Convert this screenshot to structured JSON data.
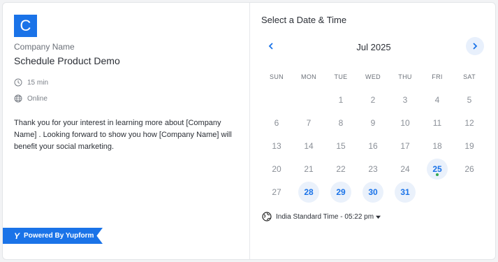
{
  "profile": {
    "logo_letter": "C",
    "company": "Company Name",
    "event_title": "Schedule Product Demo",
    "duration": "15 min",
    "location": "Online",
    "description": "Thank you for your interest in learning more about [Company Name] . Looking forward to show you how [Company Name] will benefit your social marketing."
  },
  "branding": {
    "powered_by": "Powered By Yupform",
    "brand_color": "#1a73e8"
  },
  "calendar": {
    "heading": "Select a Date & Time",
    "month": "Jul 2025",
    "weekdays": [
      "SUN",
      "MON",
      "TUE",
      "WED",
      "THU",
      "FRI",
      "SAT"
    ],
    "weeks": [
      [
        "",
        "",
        "1",
        "2",
        "3",
        "4",
        "5"
      ],
      [
        "6",
        "7",
        "8",
        "9",
        "10",
        "11",
        "12"
      ],
      [
        "13",
        "14",
        "15",
        "16",
        "17",
        "18",
        "19"
      ],
      [
        "20",
        "21",
        "22",
        "23",
        "24",
        "25",
        "26"
      ],
      [
        "27",
        "28",
        "29",
        "30",
        "31",
        "",
        ""
      ]
    ],
    "available_days": [
      "25",
      "28",
      "29",
      "30",
      "31"
    ],
    "today": "25",
    "available_color": "#1a73e8",
    "today_dot_color": "#34a853"
  },
  "timezone": {
    "label": "India Standard Time - 05:22 pm"
  }
}
